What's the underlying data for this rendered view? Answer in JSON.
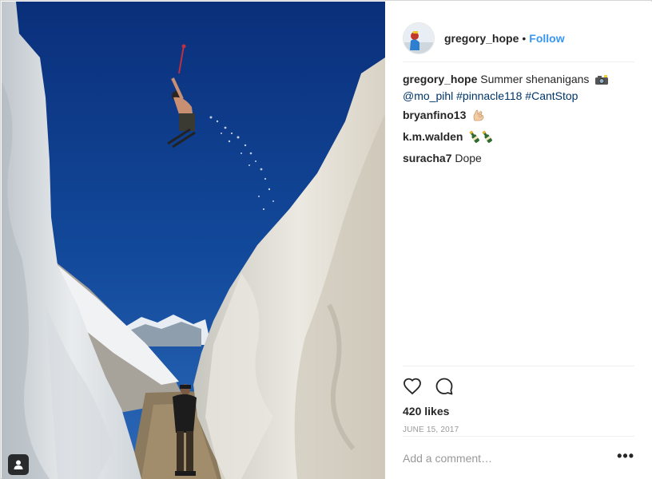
{
  "post": {
    "author": "gregory_hope",
    "follow_label": "Follow",
    "separator": "•",
    "likes": "420 likes",
    "date": "June 15, 2017"
  },
  "caption": {
    "user": "gregory_hope",
    "text": "Summer shenanigans",
    "emoji": "camera-with-flash-icon",
    "mention": "@mo_pihl",
    "tags": [
      "#pinnacle118",
      "#CantStop"
    ]
  },
  "comments": [
    {
      "user": "bryanfino13",
      "text": "",
      "emoji": "ok-hand-icon"
    },
    {
      "user": "k.m.walden",
      "text": "",
      "emoji": "champagne-bottles-icon"
    },
    {
      "user": "suracha7",
      "text": "Dope",
      "emoji": ""
    }
  ],
  "add_comment": {
    "placeholder": "Add a comment…"
  },
  "more_label": "•••",
  "colors": {
    "follow": "#3897f0",
    "hashtag": "#003569",
    "sky": "#0e3b8c"
  }
}
